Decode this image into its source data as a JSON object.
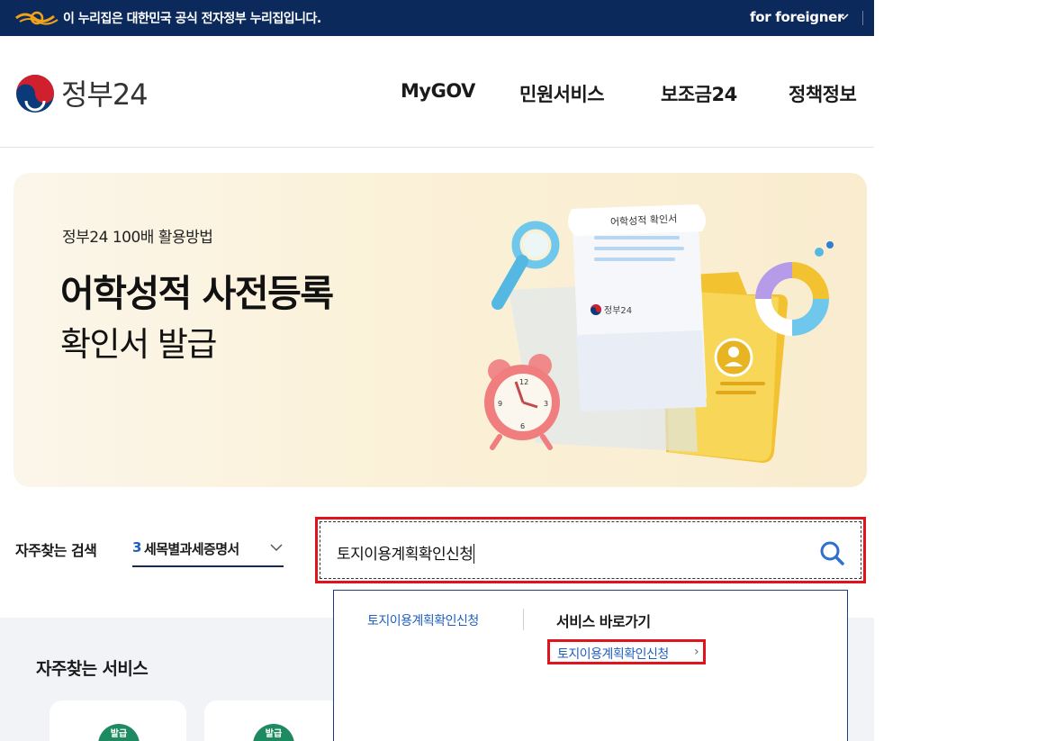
{
  "gov_banner": {
    "text": "이 누리집은 대한민국 공식 전자정부 누리집입니다.",
    "foreigner_label": "for foreigner",
    "background_color": "#0b2a5b"
  },
  "header": {
    "logo_text": "정부24",
    "nav": [
      "MyGOV",
      "민원서비스",
      "보조금24",
      "정책정보"
    ]
  },
  "hero": {
    "eyebrow": "정부24 100배 활용방법",
    "title": "어학성적 사전등록",
    "subtitle": "확인서 발급",
    "doc_caption": "어학성적 확인서",
    "doc_logo_text": "정부24"
  },
  "search": {
    "label": "자주찾는 검색",
    "keyword_rank": "3",
    "keyword_text": "세목별과세증명서",
    "input_value": "토지이용계획확인신청",
    "highlight_color": "#e0141e"
  },
  "autocomplete": {
    "suggestion": "토지이용계획확인신청",
    "shortcut_heading": "서비스 바로가기",
    "shortcut_link": "토지이용계획확인신청",
    "shortcut_chevron": "›"
  },
  "services": {
    "title": "자주찾는 서비스",
    "cards": [
      {
        "icon_text": "발급"
      },
      {
        "icon_text": "발급"
      }
    ]
  }
}
